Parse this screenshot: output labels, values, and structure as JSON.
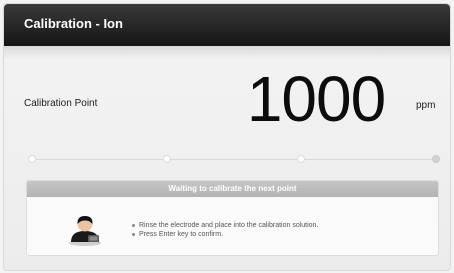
{
  "window": {
    "title": "Calibration - Ion"
  },
  "calibration": {
    "label": "Calibration Point",
    "value": "1000",
    "unit": "ppm"
  },
  "progress": {
    "total_points": 4,
    "completed_points": 3
  },
  "status": {
    "header": "Waiting to calibrate the next point",
    "icon": "user-icon",
    "instructions": [
      "Rinse the electrode and place into the calibration solution.",
      "Press Enter key to confirm."
    ]
  },
  "colors": {
    "titlebar": "#1e1e1e",
    "status_header": "#bdbdbd",
    "background": "#efefef"
  }
}
